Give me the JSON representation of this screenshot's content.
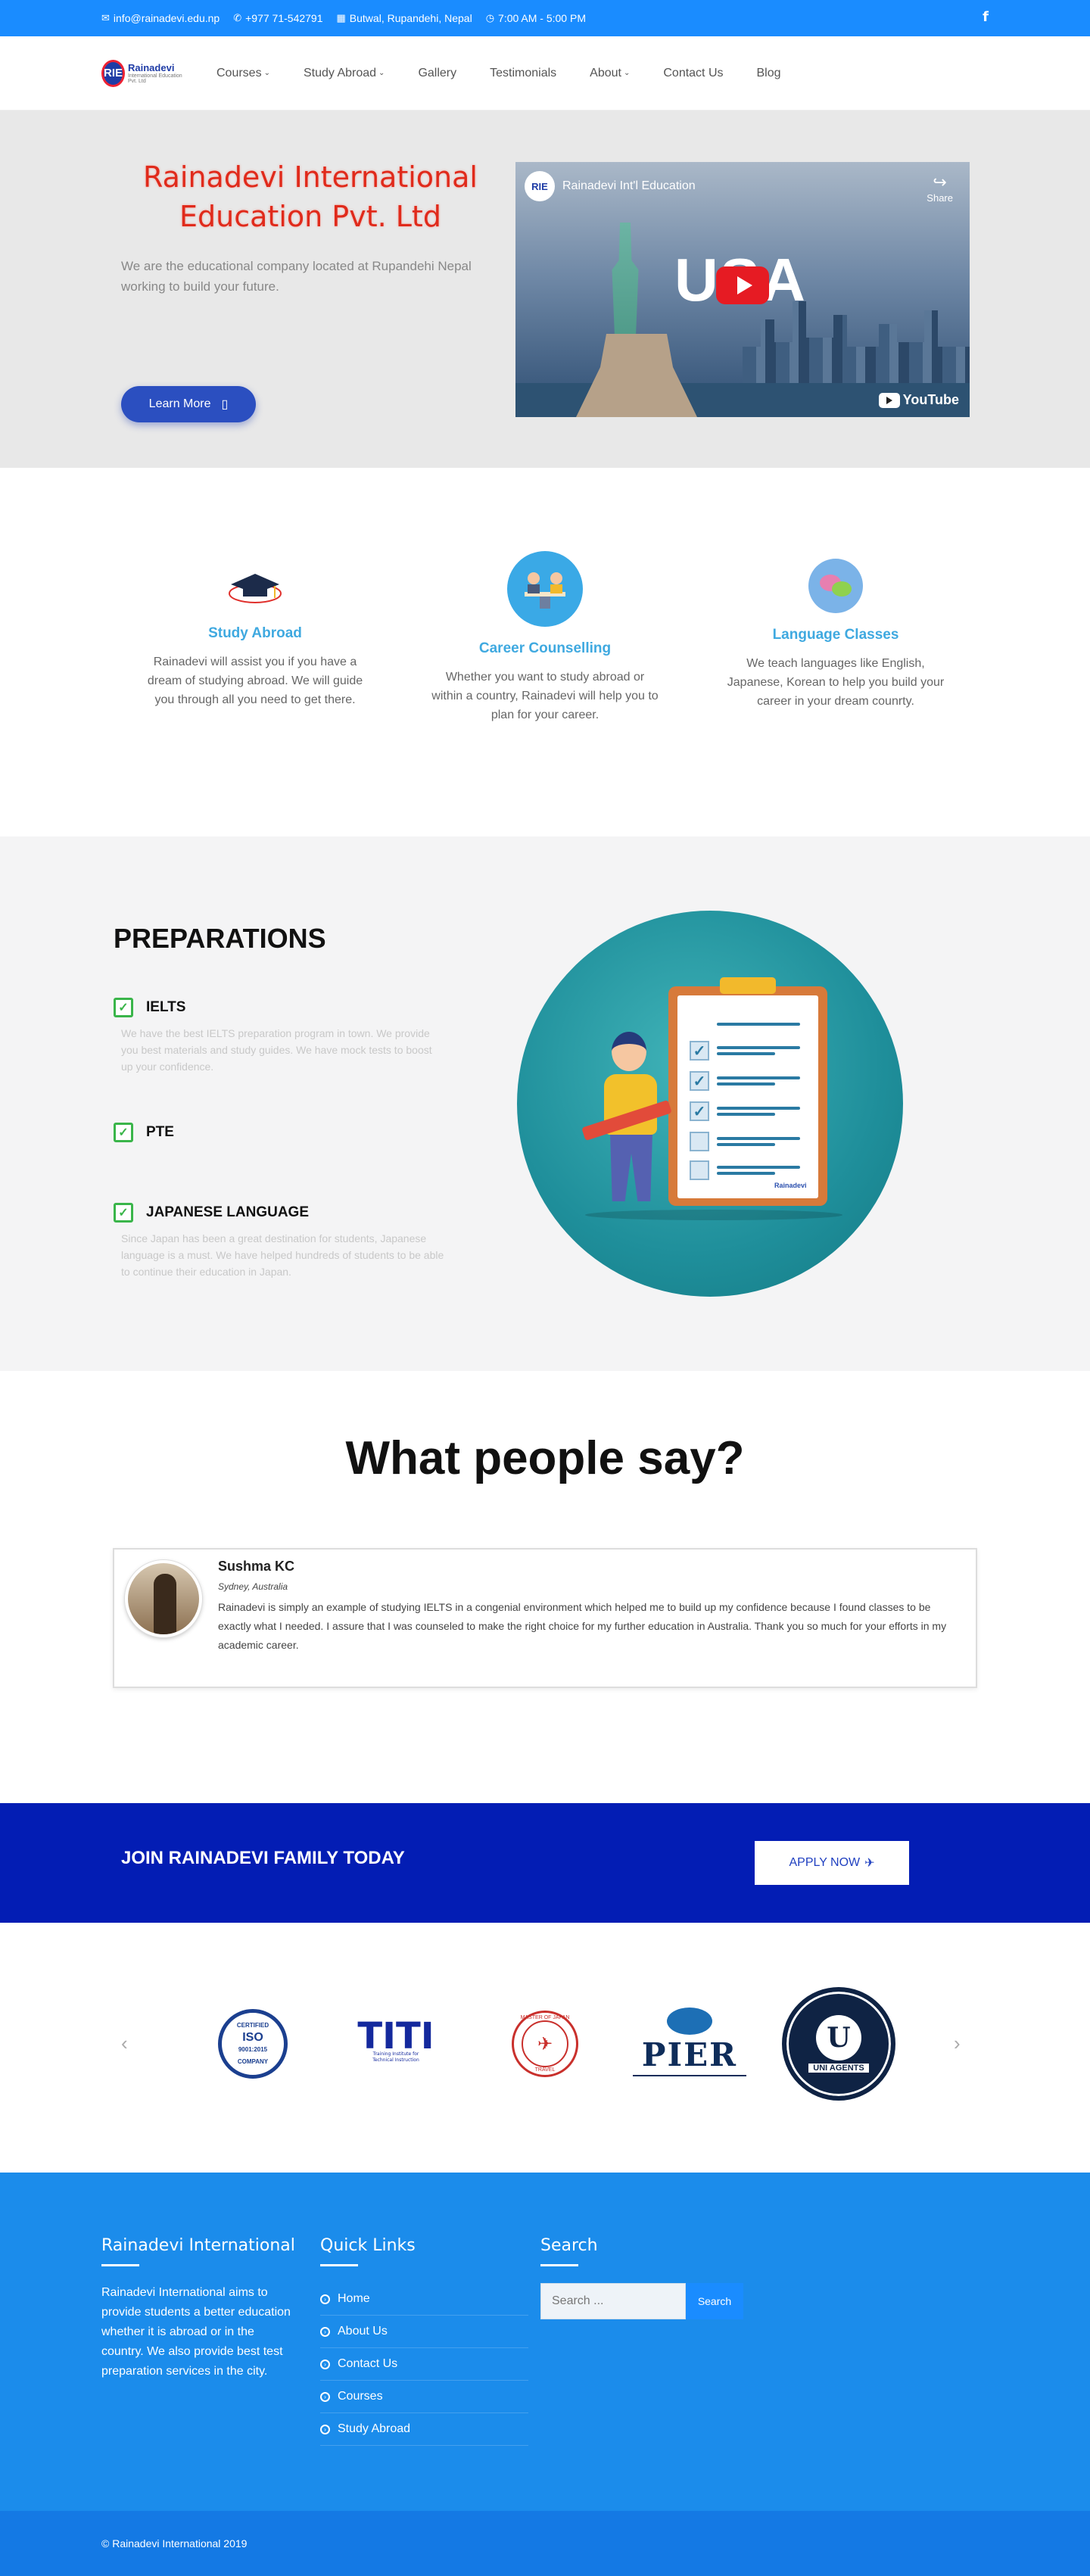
{
  "topbar": {
    "email": "info@rainadevi.edu.np",
    "phone": "+977 71-542791",
    "address": "Butwal, Rupandehi, Nepal",
    "hours": "7:00 AM - 5:00 PM",
    "social_icon": "facebook-icon"
  },
  "brand": {
    "logo_mark": "RIE",
    "name": "Rainadevi",
    "tagline": "International Education Pvt. Ltd"
  },
  "nav": {
    "items": [
      {
        "label": "Courses",
        "dropdown": true
      },
      {
        "label": "Study Abroad",
        "dropdown": true
      },
      {
        "label": "Gallery",
        "dropdown": false
      },
      {
        "label": "Testimonials",
        "dropdown": false
      },
      {
        "label": "About",
        "dropdown": true
      },
      {
        "label": "Contact Us",
        "dropdown": false
      },
      {
        "label": "Blog",
        "dropdown": false
      }
    ]
  },
  "hero": {
    "title": "Rainadevi International Education Pvt. Ltd",
    "subtitle": "We are the educational company located at Rupandehi Nepal working to build your future.",
    "cta_label": "Learn More",
    "video": {
      "channel_mark": "RIE",
      "title": "Rainadevi Int'l Education",
      "share_label": "Share",
      "overlay_text": "USA",
      "platform_label": "YouTube"
    }
  },
  "services": [
    {
      "title": "Study Abroad",
      "text": "Rainadevi will assist you if you have a dream of studying abroad. We will guide you through all you need to get there.",
      "icon": "graduation-cap-icon"
    },
    {
      "title": "Career Counselling",
      "text": "Whether you want to study abroad or within a country, Rainadevi will help you to plan for your career.",
      "icon": "counselling-icon"
    },
    {
      "title": "Language Classes",
      "text": "We teach languages like English, Japanese, Korean to help you build your career in your dream counrty.",
      "icon": "language-icon"
    }
  ],
  "preparations": {
    "heading": "PREPARATIONS",
    "items": [
      {
        "title": "IELTS",
        "text": "We have the best IELTS preparation program in town. We provide you best materials and study guides. We have mock tests to boost up your confidence."
      },
      {
        "title": "PTE",
        "text": ""
      },
      {
        "title": "JAPANESE LANGUAGE",
        "text": "Since Japan has been a great destination for students, Japanese language is a must. We have helped hundreds of students to be able to continue their education in Japan."
      }
    ],
    "illustration_brand": "Rainadevi"
  },
  "testimonials": {
    "heading": "What people say?",
    "items": [
      {
        "name": "Sushma KC",
        "location": "Sydney, Australia",
        "quote": "Rainadevi is simply an example of studying IELTS in a congenial environment which helped me to build up my confidence because I found classes to be exactly what I needed. I assure that I was counseled to make the right choice for my further education in Australia. Thank you so much for your efforts in my academic career."
      }
    ]
  },
  "cta": {
    "heading": "JOIN RAINADEVI FAMILY TODAY",
    "button_label": "APPLY NOW"
  },
  "partners": {
    "prev_icon": "chevron-left-icon",
    "next_icon": "chevron-right-icon",
    "logos": [
      {
        "name": "ISO Certified",
        "line1": "CERTIFIED",
        "line2": "ISO",
        "line3": "9001:2015",
        "line4": "COMPANY"
      },
      {
        "name": "TITI",
        "line1": "TITI",
        "line2": "Training Institute for Technical Instruction"
      },
      {
        "name": "Master of Japan Travel",
        "line1": "MASTER OF JAPAN",
        "line2": "TRAVEL"
      },
      {
        "name": "PIER",
        "line1": "PIER"
      },
      {
        "name": "Uni Agents",
        "line1": "U",
        "line2": "UNI AGENTS",
        "ring": "UNIAGENTS CERTIFIED AGENT"
      }
    ]
  },
  "footer": {
    "about": {
      "heading": "Rainadevi International",
      "text": "Rainadevi International aims to provide students a better education whether it is abroad or in the country. We also provide best test preparation services in the city."
    },
    "quick_links": {
      "heading": "Quick Links",
      "items": [
        "Home",
        "About Us",
        "Contact Us",
        "Courses",
        "Study Abroad"
      ]
    },
    "search": {
      "heading": "Search",
      "placeholder": "Search ...",
      "button_label": "Search"
    },
    "copyright": "© Rainadevi International 2019"
  },
  "colors": {
    "topbar": "#1a8cff",
    "hero_title": "#e02a1b",
    "cta_band": "#031db4",
    "footer": "#1b8ceb",
    "service_title": "#3fa9e0"
  }
}
